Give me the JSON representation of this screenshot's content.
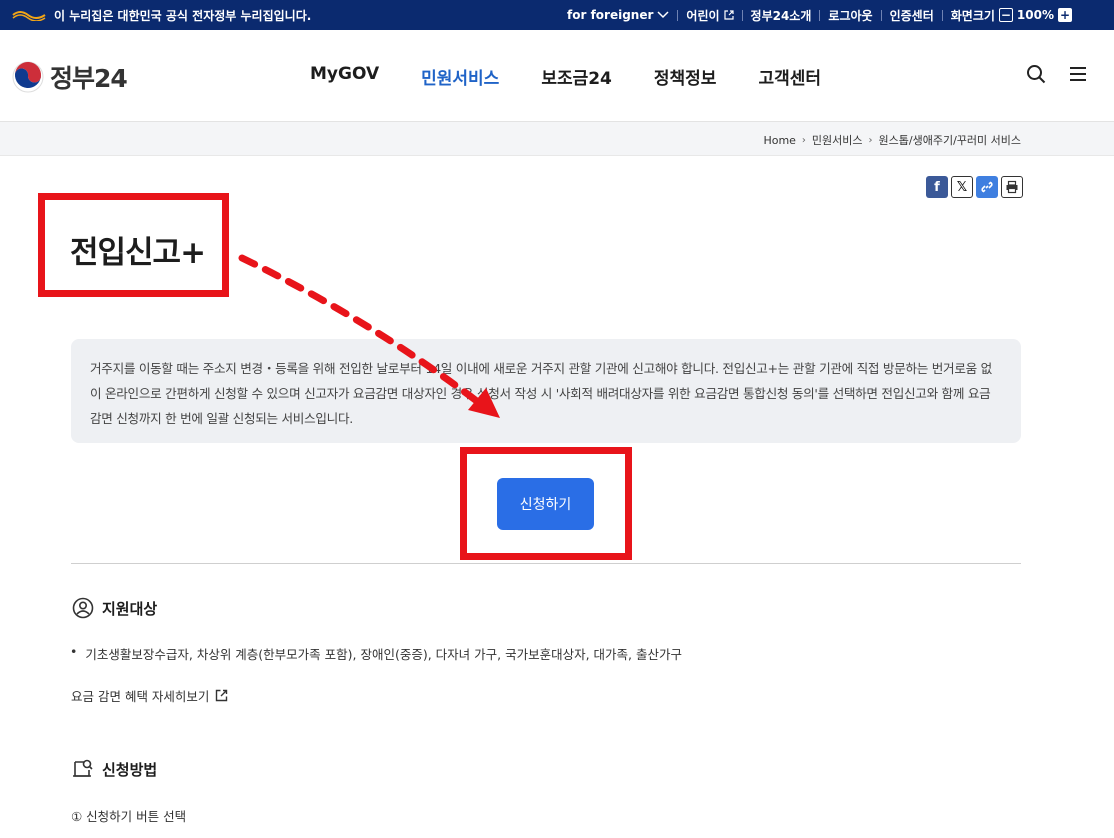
{
  "govbar": {
    "notice": "이 누리집은 대한민국 공식 전자정부 누리집입니다.",
    "foreigner": "for foreigner",
    "kids": "어린이",
    "about": "정부24소개",
    "logout": "로그아웃",
    "cert": "인증센터",
    "zoom_label": "화면크기",
    "zoom_value": "100%"
  },
  "header": {
    "logo_text": "정부24",
    "nav": [
      "MyGOV",
      "민원서비스",
      "보조금24",
      "정책정보",
      "고객센터"
    ],
    "active_nav": "민원서비스"
  },
  "breadcrumb": [
    "Home",
    "민원서비스",
    "원스톱/생애주기/꾸러미 서비스"
  ],
  "page": {
    "title": "전입신고+",
    "description": "거주지를 이동할 때는 주소지 변경・등록을 위해 전입한 날로부터 14일 이내에 새로운 거주지 관할 기관에 신고해야 합니다. 전입신고+는 관할 기관에 직접 방문하는 번거로움 없이 온라인으로 간편하게 신청할 수 있으며 신고자가 요금감면 대상자인 경우 신청서 작성 시 '사회적 배려대상자를 위한 요금감면 통합신청 동의'를 선택하면 전입신고와 함께 요금감면 신청까지 한 번에 일괄 신청되는 서비스입니다.",
    "apply_button": "신청하기"
  },
  "support": {
    "heading": "지원대상",
    "bullet": "기초생활보장수급자, 차상위 계층(한부모가족 포함), 장애인(중증), 다자녀 가구, 국가보훈대상자, 대가족, 출산가구",
    "detail_link": "요금 감면 혜택 자세히보기"
  },
  "method": {
    "heading": "신청방법",
    "step1": "① 신청하기 버튼 선택"
  },
  "colors": {
    "govbar": "#0b2a6f",
    "active": "#1f63c7",
    "button": "#2a6ee6",
    "annotation": "#e8141a"
  }
}
